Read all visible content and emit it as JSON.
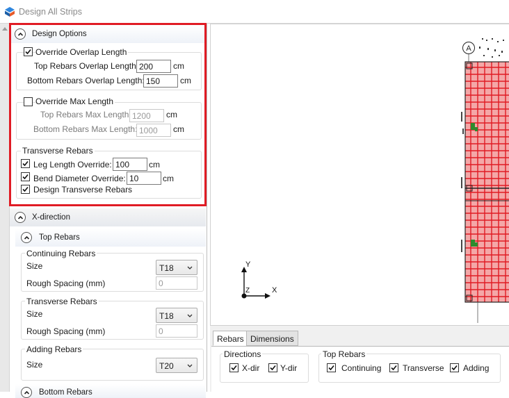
{
  "window": {
    "title": "Design All Strips"
  },
  "design_options": {
    "header": "Design Options",
    "override_overlap": {
      "label": "Override Overlap Length",
      "checked": true,
      "top_label": "Top Rebars Overlap Length:",
      "top_value": "200",
      "top_unit": "cm",
      "bottom_label": "Bottom Rebars Overlap Length:",
      "bottom_value": "150",
      "bottom_unit": "cm"
    },
    "override_max": {
      "label": "Override Max Length",
      "checked": false,
      "top_label": "Top Rebars Max Length:",
      "top_value": "1200",
      "top_unit": "cm",
      "bottom_label": "Bottom Rebars Max Length:",
      "bottom_value": "1000",
      "bottom_unit": "cm"
    },
    "transverse": {
      "title": "Transverse Rebars",
      "leg_label": "Leg Length Override:",
      "leg_value": "100",
      "leg_unit": "cm",
      "leg_checked": true,
      "bend_label": "Bend Diameter Override:",
      "bend_value": "10",
      "bend_unit": "cm",
      "bend_checked": true,
      "design_label": "Design Transverse Rebars",
      "design_checked": true
    }
  },
  "x_direction": {
    "header": "X-direction",
    "top_rebars": {
      "header": "Top Rebars",
      "continuing": {
        "title": "Continuing Rebars",
        "size_label": "Size",
        "size_value": "T18",
        "spacing_label": "Rough Spacing (mm)",
        "spacing_value": "0"
      },
      "transverse": {
        "title": "Transverse Rebars",
        "size_label": "Size",
        "size_value": "T18",
        "spacing_label": "Rough Spacing (mm)",
        "spacing_value": "0"
      },
      "adding": {
        "title": "Adding Rebars",
        "size_label": "Size",
        "size_value": "T20"
      }
    },
    "bottom_rebars": {
      "header": "Bottom Rebars"
    }
  },
  "canvas": {
    "axis_y": "Y",
    "axis_x": "X",
    "axis_z": "Z",
    "grid_bubble": "A",
    "highlight_color": "#e01b24",
    "strip_color": "#e83a3a"
  },
  "bottom_tabs": {
    "tabs": [
      "Rebars",
      "Dimensions"
    ],
    "active": "Rebars",
    "directions": {
      "title": "Directions",
      "x_label": "X-dir",
      "x_checked": true,
      "y_label": "Y-dir",
      "y_checked": true
    },
    "top_rebars": {
      "title": "Top Rebars",
      "continuing_label": "Continuing",
      "continuing_checked": true,
      "transverse_label": "Transverse",
      "transverse_checked": true,
      "adding_label": "Adding",
      "adding_checked": true
    }
  }
}
